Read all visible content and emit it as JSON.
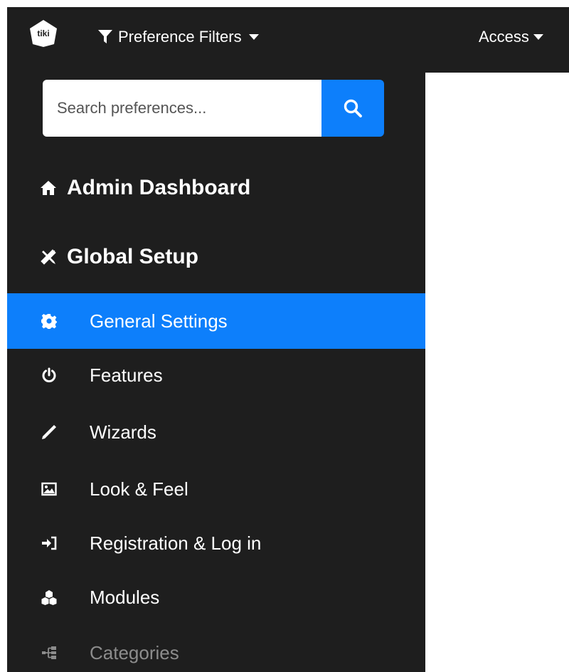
{
  "topbar": {
    "logo_text": "tiki",
    "filter_menu_label": "Preference Filters",
    "access_menu_label": "Access"
  },
  "search": {
    "placeholder": "Search preferences...",
    "button_icon": "search-icon"
  },
  "sidebar": {
    "sections": [
      {
        "label": "Admin Dashboard",
        "icon": "home-icon"
      },
      {
        "label": "Global Setup",
        "icon": "tools-icon"
      }
    ],
    "items": [
      {
        "label": "General Settings",
        "icon": "gear-icon",
        "active": true
      },
      {
        "label": "Features",
        "icon": "power-icon"
      },
      {
        "label": "Wizards",
        "icon": "wand-icon"
      },
      {
        "label": "Look & Feel",
        "icon": "image-icon"
      },
      {
        "label": "Registration & Log in",
        "icon": "login-icon"
      },
      {
        "label": "Modules",
        "icon": "cubes-icon"
      },
      {
        "label": "Categories",
        "icon": "sitemap-icon",
        "muted": true
      }
    ]
  },
  "colors": {
    "dark_bg": "#1e1e1e",
    "accent": "#0d7ffb",
    "text": "#ffffff",
    "muted_text": "#8c8c8c"
  }
}
